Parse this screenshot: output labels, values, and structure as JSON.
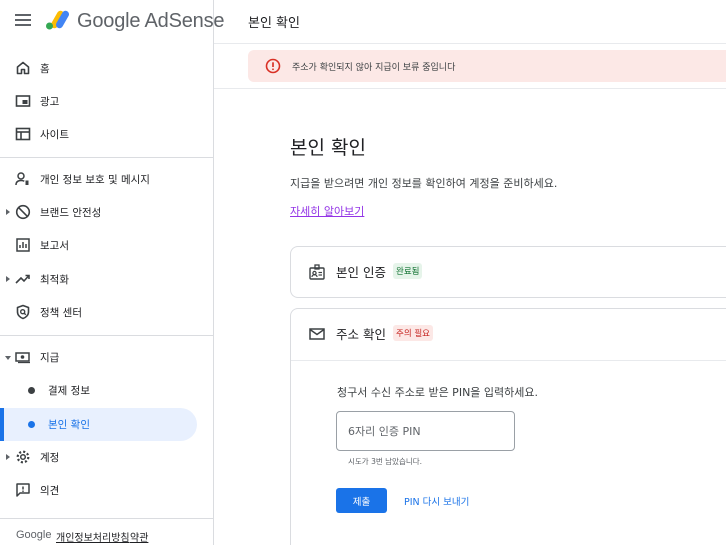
{
  "brand": {
    "name": "Google AdSense"
  },
  "header": {
    "title": "본인 확인"
  },
  "alert": {
    "text": "주소가 확인되지 않아 지급이 보류 중입니다",
    "icon": "error-icon",
    "color": "#d93025"
  },
  "sidebar": {
    "items": [
      {
        "label": "홈",
        "icon": "home-icon"
      },
      {
        "label": "광고",
        "icon": "ads-icon"
      },
      {
        "label": "사이트",
        "icon": "sites-icon"
      },
      {
        "label": "개인 정보 보호 및 메시지",
        "icon": "privacy-messaging-icon"
      },
      {
        "label": "브랜드 안전성",
        "icon": "brand-safety-icon"
      },
      {
        "label": "보고서",
        "icon": "reports-icon"
      },
      {
        "label": "최적화",
        "icon": "optimization-icon"
      },
      {
        "label": "정책 센터",
        "icon": "policy-center-icon"
      },
      {
        "label": "지급",
        "icon": "payments-icon"
      },
      {
        "label": "계정",
        "icon": "account-gear-icon"
      },
      {
        "label": "의견",
        "icon": "feedback-icon"
      }
    ],
    "payments_sub": [
      {
        "label": "결제 정보"
      },
      {
        "label": "본인 확인",
        "active": true
      }
    ],
    "footer": {
      "google": "Google",
      "privacy": "개인정보처리방침",
      "terms": "약관"
    }
  },
  "main": {
    "title": "본인 확인",
    "description": "지급을 받으려면 개인 정보를 확인하여 계정을 준비하세요.",
    "learn_more": "자세히 알아보기",
    "identity_card": {
      "title": "본인 인증",
      "badge": "완료됨"
    },
    "address_card": {
      "title": "주소 확인",
      "badge": "주의 필요",
      "instruction": "청구서 수신 주소로 받은 PIN을 입력하세요.",
      "pin_placeholder": "6자리 인증 PIN",
      "pin_value": "",
      "attempts_left": "시도가 3번 남았습니다.",
      "submit_label": "제출",
      "resend_label": "PIN 다시 보내기"
    }
  },
  "colors": {
    "accent": "#1a73e8",
    "success_bg": "#e6f4ea",
    "success_text": "#137333",
    "warn_bg": "#fce8e6",
    "warn_text": "#c5221f"
  }
}
